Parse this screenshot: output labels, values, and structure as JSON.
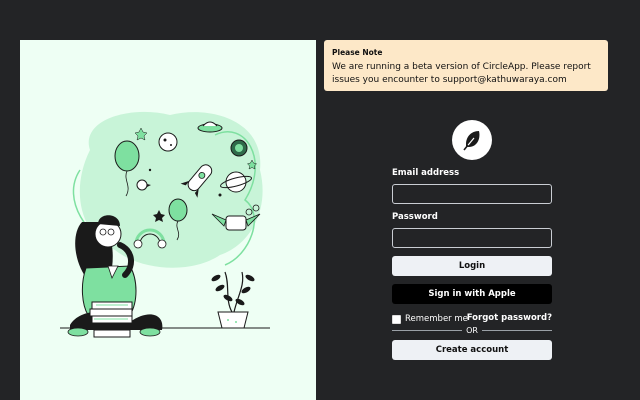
{
  "notice": {
    "title": "Please Note",
    "body": "We are running a beta version of CircleApp. Please report issues you encounter to support@kathuwaraya.com"
  },
  "logo": {
    "icon": "feather-icon"
  },
  "login_form": {
    "email_label": "Email address",
    "email_value": "",
    "email_placeholder": "",
    "password_label": "Password",
    "password_value": "",
    "password_placeholder": "",
    "login_button": "Login",
    "apple_button": " Sign in with Apple",
    "remember_label": "Remember me",
    "forgot_link": "Forgot password?",
    "or_text": "OR",
    "create_account_button": "Create account"
  },
  "colors": {
    "page_bg": "#232426",
    "illustration_bg": "#eefff4",
    "accent_green": "#7ee0a0",
    "notice_bg": "#fde8c8"
  }
}
